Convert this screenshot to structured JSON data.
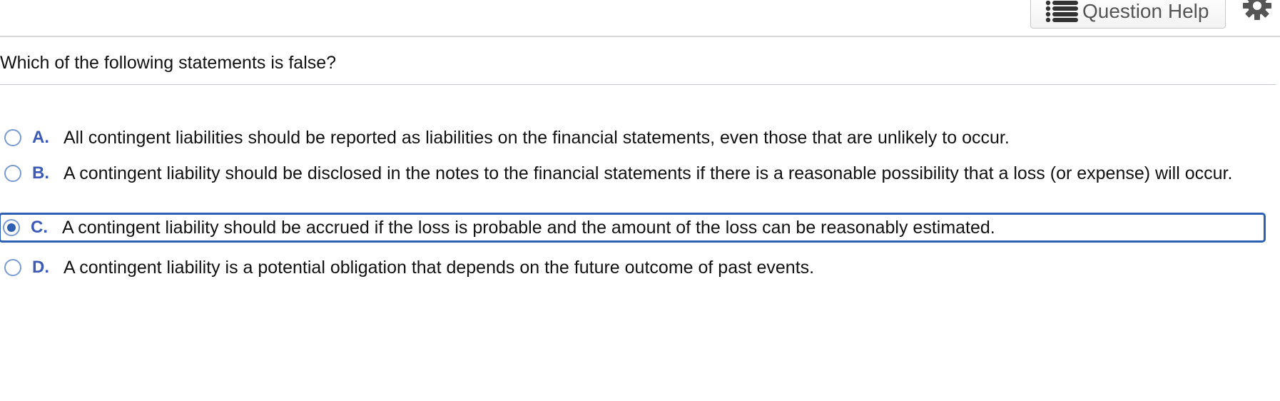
{
  "toolbar": {
    "help_label": "Question Help",
    "help_icon": "list-icon",
    "settings_icon": "gear-icon"
  },
  "question": {
    "prompt": "Which of the following statements is false?"
  },
  "options": [
    {
      "letter": "A.",
      "text": "All contingent liabilities should be reported as liabilities on the financial statements, even those that are unlikely to occur.",
      "selected": false
    },
    {
      "letter": "B.",
      "text": "A contingent liability should be disclosed in the notes to the financial statements if there is a reasonable possibility that a loss (or expense) will occur.",
      "selected": false
    },
    {
      "letter": "C.",
      "text": "A contingent liability should be accrued if the loss is probable and the amount of the loss can be reasonably estimated.",
      "selected": true
    },
    {
      "letter": "D.",
      "text": "A contingent liability is a potential obligation that depends on the future outcome of past events.",
      "selected": false
    }
  ],
  "colors": {
    "accent": "#2d5fb3",
    "letter": "#3b5bb7",
    "radio_border": "#7a9bd0"
  }
}
